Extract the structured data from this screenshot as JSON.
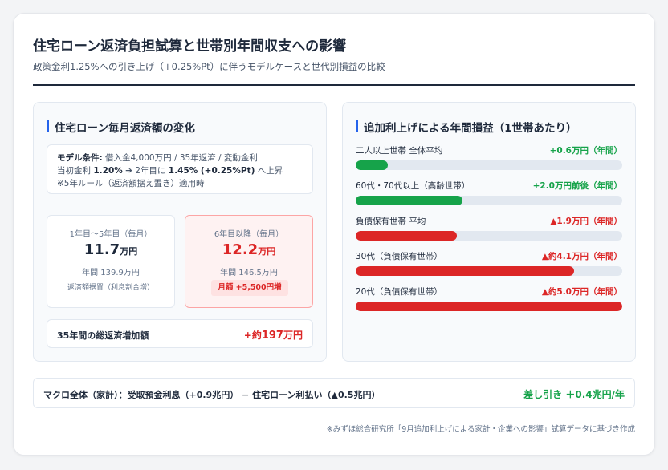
{
  "header": {
    "title": "住宅ローン返済負担試算と世帯別年間収支への影響",
    "subtitle": "政策金利1.25%への引き上げ（+0.25%Pt）に伴うモデルケースと世代別損益の比較"
  },
  "left_panel": {
    "title": "住宅ローン毎月返済額の変化",
    "model": {
      "label": "モデル条件:",
      "conditions": " 借入金4,000万円 / 35年返済 / 変動金利",
      "rate_prefix": "当初金利 ",
      "rate_initial": "1.20%",
      "rate_mid": " ➔ 2年目に ",
      "rate_new": "1.45% (+0.25%Pt)",
      "rate_suffix": " へ上昇",
      "note": "※5年ルール（返済額据え置き）適用時"
    },
    "box1": {
      "label": "1年目～5年目（毎月）",
      "value": "11.7",
      "unit": "万円",
      "yearly": "年間 139.9万円",
      "note": "返済額据置（利息割合増）"
    },
    "box2": {
      "label": "6年目以降（毎月）",
      "value": "12.2",
      "unit": "万円",
      "yearly": "年間 146.5万円",
      "badge": "月額 +5,500円増"
    },
    "total": {
      "label": "35年間の総返済増加額",
      "value_prefix": "+約",
      "value": "197",
      "unit": "万円"
    }
  },
  "right_panel": {
    "title": "追加利上げによる年間損益（1世帯あたり）",
    "rows": [
      {
        "label": "二人以上世帯 全体平均",
        "value": "+0.6万円（年間）",
        "amount": 0.6
      },
      {
        "label": "60代・70代以上（高齢世帯）",
        "value": "+2.0万円前後（年間）",
        "amount": 2.0
      },
      {
        "label": "負債保有世帯 平均",
        "value": "▲1.9万円（年間）",
        "amount": -1.9
      },
      {
        "label": "30代（負債保有世帯）",
        "value": "▲約4.1万円（年間）",
        "amount": -4.1
      },
      {
        "label": "20代（負債保有世帯）",
        "value": "▲約5.0万円（年間）",
        "amount": -5.0
      }
    ]
  },
  "macro": {
    "label": "マクロ全体（家計）：受取預金利息（+0.9兆円） − 住宅ローン利払い（▲0.5兆円）",
    "result": "差し引き ＋0.4兆円/年"
  },
  "source": "※みずほ総合研究所「9月追加利上げによる家計・企業への影響」試算データに基づき作成",
  "colors": {
    "accent": "#2563eb",
    "positive": "#16a34a",
    "negative": "#dc2626",
    "track": "#e2e8f0"
  }
}
